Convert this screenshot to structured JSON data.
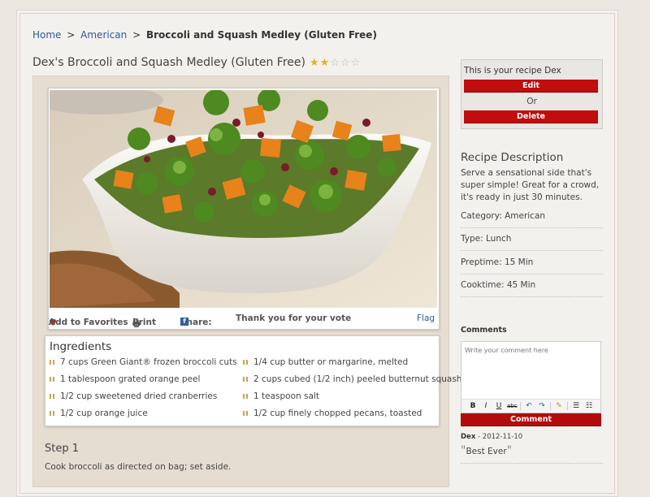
{
  "breadcrumb": {
    "home": "Home",
    "sep1": ">",
    "category": "American",
    "sep2": ">",
    "current": "Broccoli and Squash Medley (Gluten Free)"
  },
  "recipe": {
    "title": "Dex's Broccoli and Squash Medley (Gluten Free)",
    "rating": 2,
    "rating_max": 5,
    "photo_icon": "broccoli-squash-bowl-photo"
  },
  "actions": {
    "favorites": "Add to Favorites",
    "print": "Print",
    "share": "Share:",
    "vote": "Thank you for your vote",
    "flag": "Flag"
  },
  "ingredients": {
    "title": "Ingredients",
    "left": [
      "7 cups Green Giant® frozen broccoli cuts",
      "1 tablespoon grated orange peel",
      "1/2 cup sweetened dried cranberries",
      "1/2 cup orange juice"
    ],
    "right": [
      "1/4 cup butter or margarine, melted",
      "2 cups cubed (1/2 inch) peeled butternut squash",
      "1 teaspoon salt",
      "1/2 cup finely chopped pecans, toasted"
    ]
  },
  "steps": [
    {
      "title": "Step 1",
      "text": "Cook broccoli as directed on bag; set aside."
    }
  ],
  "owner": {
    "text": "This is your recipe Dex",
    "edit": "Edit",
    "or": "Or",
    "delete": "Delete"
  },
  "description": {
    "title": "Recipe Description",
    "text": "Serve a sensational side that's super simple! Great for a crowd, it's ready in just 30 minutes.",
    "category": "Category: American",
    "type": "Type: Lunch",
    "preptime": "Preptime: 15 Min",
    "cooktime": "Cooktime: 45 Min"
  },
  "comments": {
    "title": "Comments",
    "placeholder": "Write your comment here",
    "submit": "Comment",
    "items": [
      {
        "author": "Dex",
        "date": "- 2012-11-10",
        "text": "Best Ever"
      }
    ]
  },
  "colors": {
    "accent_red": "#c00d0d",
    "link_blue": "#2a5a9c",
    "star_gold": "#e5b41b"
  }
}
